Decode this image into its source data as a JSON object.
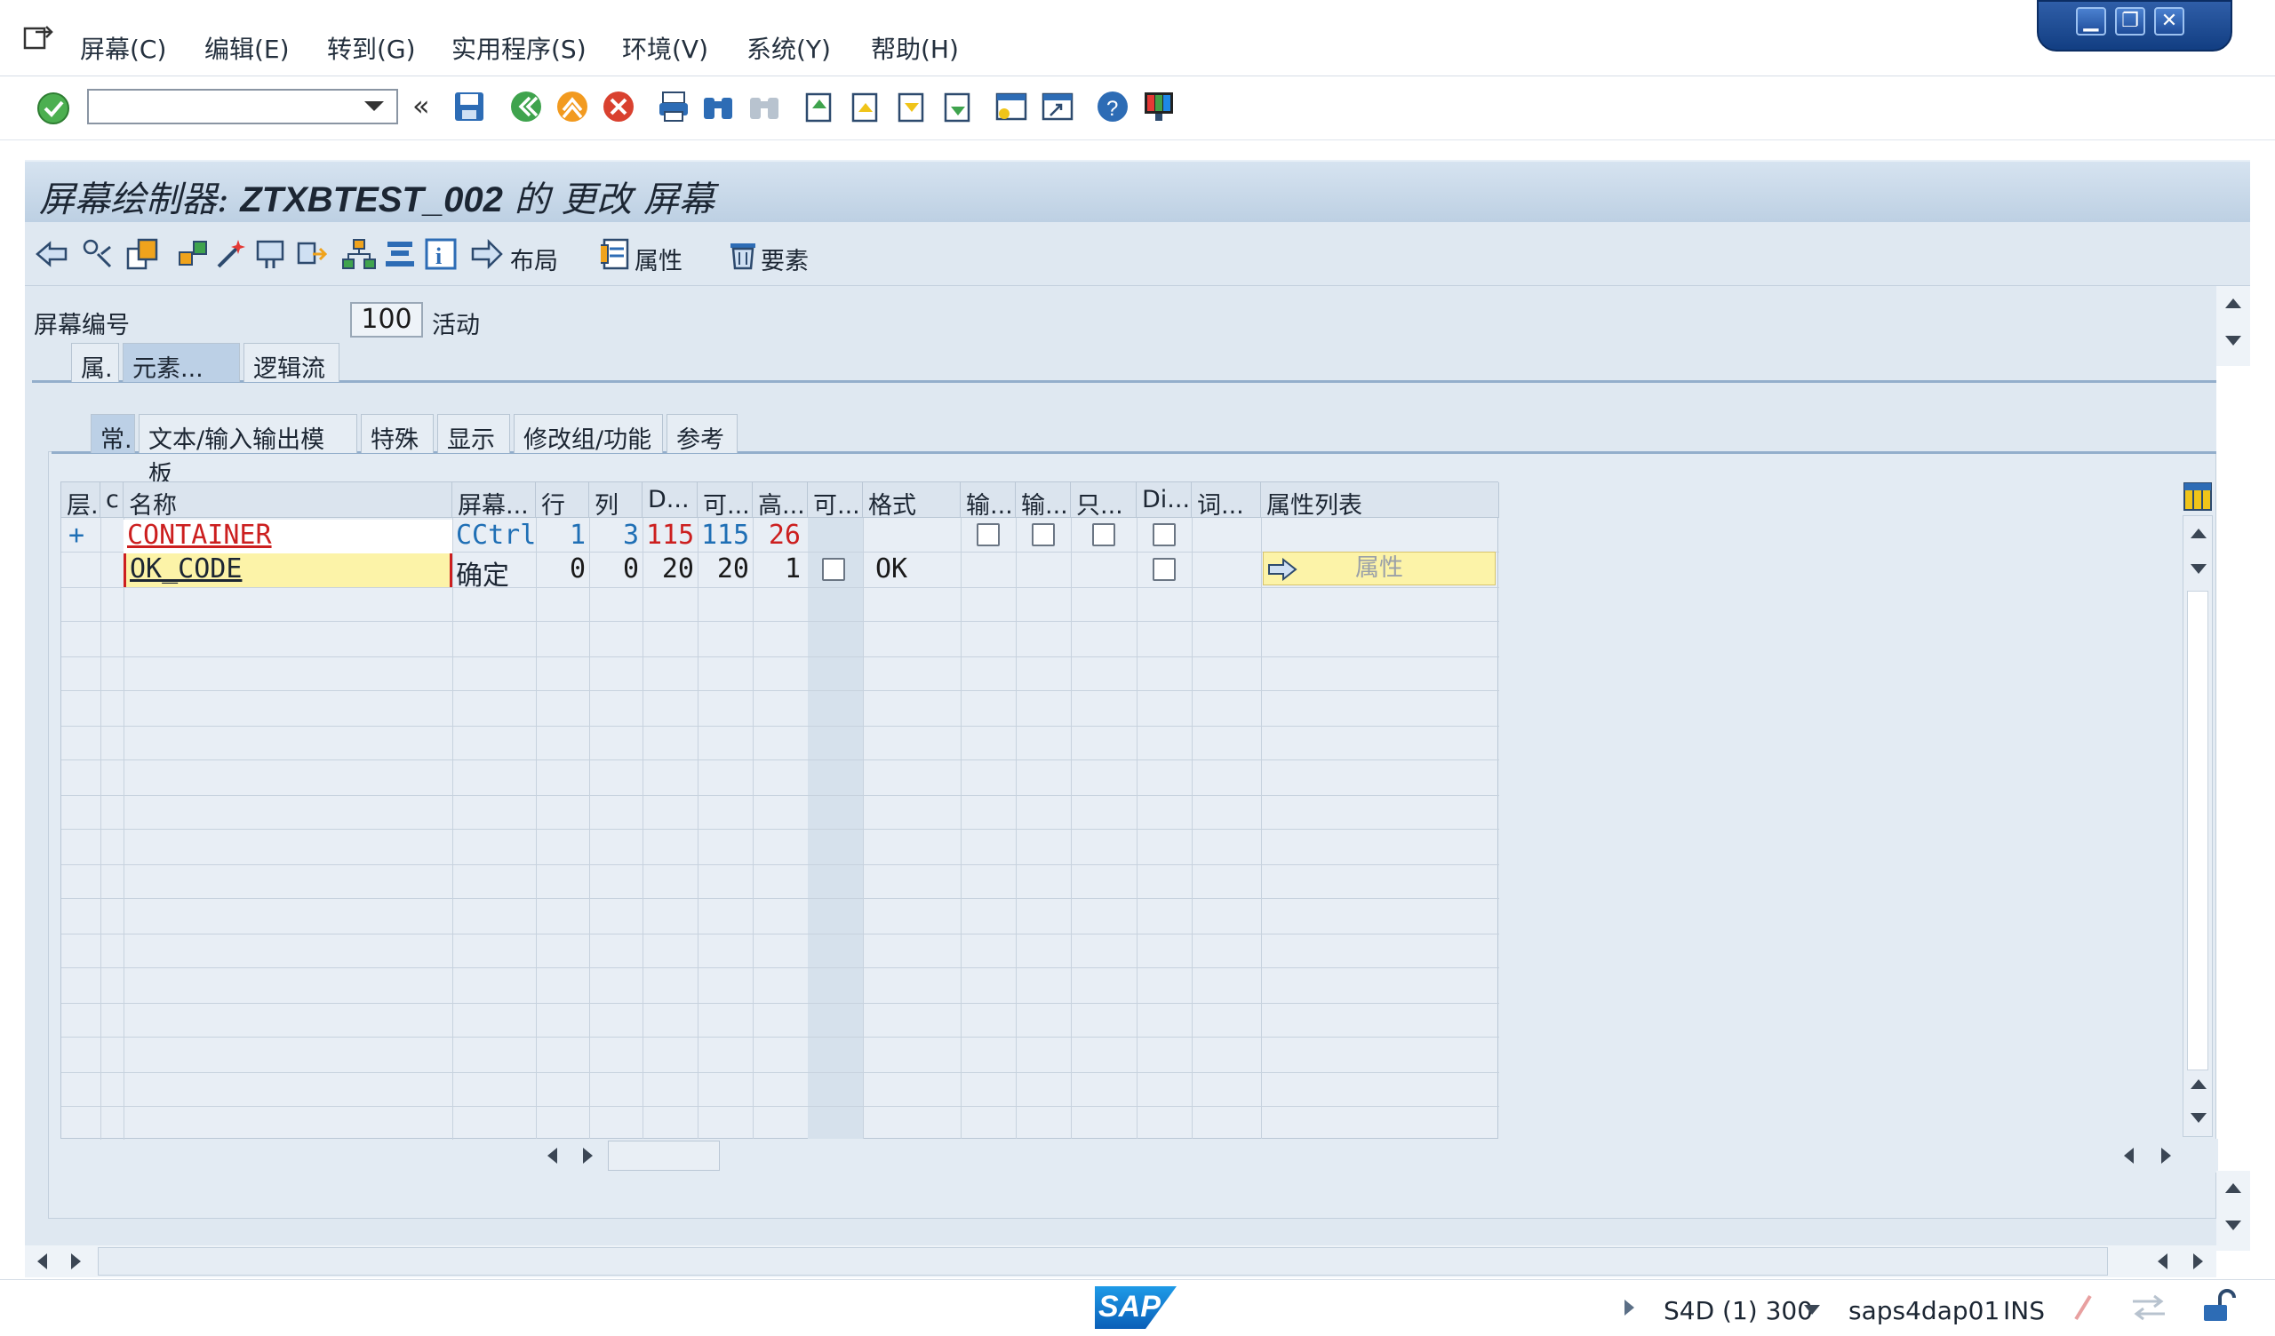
{
  "menu": {
    "items": [
      "屏幕(C)",
      "编辑(E)",
      "转到(G)",
      "实用程序(S)",
      "环境(V)",
      "系统(Y)",
      "帮助(H)"
    ]
  },
  "window_controls": {
    "minimize": "▁",
    "restore": "❐",
    "close": "✕"
  },
  "toolbar": {
    "command_value": "",
    "nav_chevron": "«"
  },
  "title": {
    "prefix": "屏幕绘制器: ",
    "program": "ZTXBTEST_002",
    "suffix": " 的 更改 屏幕"
  },
  "app_toolbar": {
    "layout": "布局",
    "attributes": "属性",
    "elements": "要素"
  },
  "screen": {
    "number_label": "屏幕编号",
    "number_value": "100",
    "status": "活动"
  },
  "tabs_main": [
    "属.",
    "元素...",
    "逻辑流"
  ],
  "tabs_sub": [
    "常.",
    "文本/输入输出模板",
    "特殊",
    "显示",
    "修改组/功能",
    "参考"
  ],
  "table": {
    "headers": [
      "层.",
      "c",
      "名称",
      "屏幕...",
      "行",
      "列",
      "D...",
      "可...",
      "高...",
      "可...",
      "格式",
      "输...",
      "输...",
      "只...",
      "Di...",
      "词...",
      "属性列表"
    ],
    "rows": [
      {
        "level": "+",
        "name": "CONTAINER",
        "type": "CCtrl",
        "row": "1",
        "col": "3",
        "def_len": "115",
        "vis_len": "115",
        "height": "26"
      },
      {
        "level": "",
        "name": "OK_CODE",
        "type": "确定",
        "row": "0",
        "col": "0",
        "def_len": "20",
        "vis_len": "20",
        "height": "1",
        "format": "OK",
        "attr_button": "属性"
      }
    ]
  },
  "status_bar": {
    "system": "S4D (1) 300",
    "server": "saps4dap01",
    "mode": "INS",
    "logo": "SAP"
  },
  "colors": {
    "accent": "#1e9be8",
    "name_red": "#cc1f1f",
    "value_blue": "#1f6fb5",
    "highlight_yellow": "#fcf3a8",
    "pane_bg": "#dfe8f1"
  }
}
